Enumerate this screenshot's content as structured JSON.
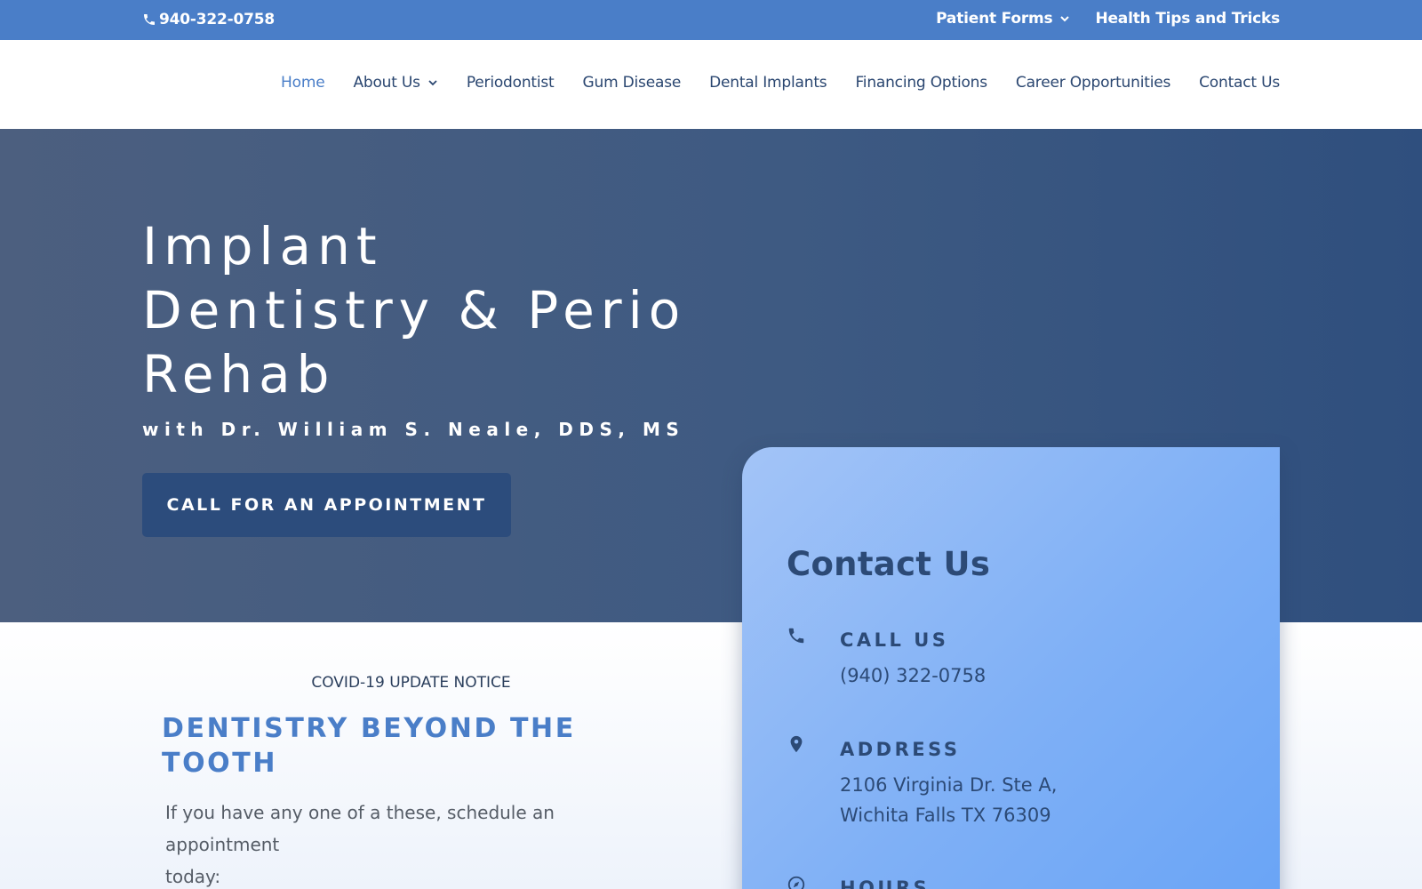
{
  "topbar": {
    "phone": "940-322-0758",
    "links": [
      {
        "label": "Patient Forms",
        "has_dropdown": true
      },
      {
        "label": "Health Tips and Tricks",
        "has_dropdown": false
      }
    ]
  },
  "nav": {
    "items": [
      {
        "label": "Home",
        "active": true
      },
      {
        "label": "About Us",
        "has_dropdown": true
      },
      {
        "label": "Periodontist"
      },
      {
        "label": "Gum Disease"
      },
      {
        "label": "Dental Implants"
      },
      {
        "label": "Financing Options"
      },
      {
        "label": "Career Opportunities"
      },
      {
        "label": "Contact Us"
      }
    ]
  },
  "hero": {
    "title_line1": "Implant",
    "title_line2": "Dentistry & Perio",
    "title_line3": "Rehab",
    "subtitle": "with Dr. William S. Neale, DDS, MS",
    "cta_label": "CALL FOR AN APPOINTMENT"
  },
  "main": {
    "notice": "COVID-19 UPDATE NOTICE",
    "headline_line1": "DENTISTRY BEYOND THE",
    "headline_line2": "TOOTH",
    "body_line1": "If you have any one of a these, schedule an appointment",
    "body_line2": "today:"
  },
  "contact_card": {
    "title": "Contact Us",
    "call": {
      "label": "CALL US",
      "value": "(940) 322-0758",
      "icon": "phone-icon"
    },
    "address": {
      "label": "ADDRESS",
      "line1": "2106 Virginia Dr. Ste A,",
      "line2": "Wichita Falls TX 76309",
      "icon": "map-pin-icon"
    },
    "hours": {
      "label": "HOURS",
      "icon": "compass-icon"
    }
  },
  "colors": {
    "topbar": "#4a7ec8",
    "nav_text": "#2a4670",
    "nav_active": "#4a7ec8",
    "hero_button": "#2c4c7c",
    "headline": "#4a7ec8",
    "card_text": "#2c4a76"
  }
}
